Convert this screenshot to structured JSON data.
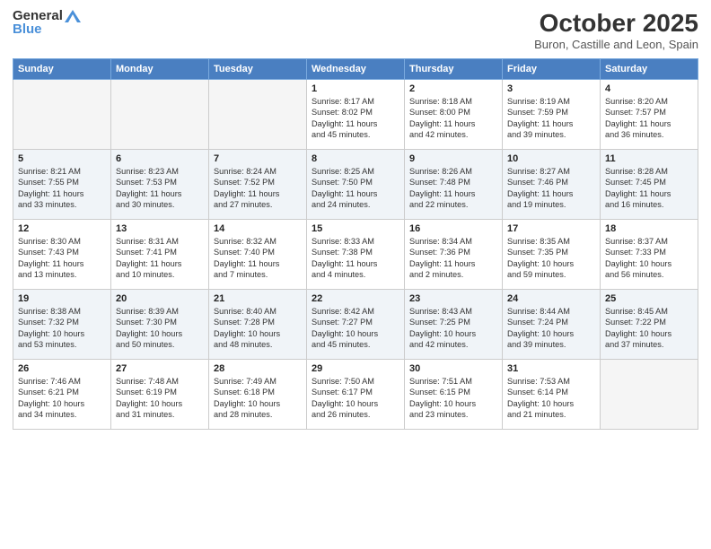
{
  "header": {
    "logo_general": "General",
    "logo_blue": "Blue",
    "month_title": "October 2025",
    "subtitle": "Buron, Castille and Leon, Spain"
  },
  "weekdays": [
    "Sunday",
    "Monday",
    "Tuesday",
    "Wednesday",
    "Thursday",
    "Friday",
    "Saturday"
  ],
  "weeks": [
    [
      {
        "day": "",
        "info": ""
      },
      {
        "day": "",
        "info": ""
      },
      {
        "day": "",
        "info": ""
      },
      {
        "day": "1",
        "info": "Sunrise: 8:17 AM\nSunset: 8:02 PM\nDaylight: 11 hours\nand 45 minutes."
      },
      {
        "day": "2",
        "info": "Sunrise: 8:18 AM\nSunset: 8:00 PM\nDaylight: 11 hours\nand 42 minutes."
      },
      {
        "day": "3",
        "info": "Sunrise: 8:19 AM\nSunset: 7:59 PM\nDaylight: 11 hours\nand 39 minutes."
      },
      {
        "day": "4",
        "info": "Sunrise: 8:20 AM\nSunset: 7:57 PM\nDaylight: 11 hours\nand 36 minutes."
      }
    ],
    [
      {
        "day": "5",
        "info": "Sunrise: 8:21 AM\nSunset: 7:55 PM\nDaylight: 11 hours\nand 33 minutes."
      },
      {
        "day": "6",
        "info": "Sunrise: 8:23 AM\nSunset: 7:53 PM\nDaylight: 11 hours\nand 30 minutes."
      },
      {
        "day": "7",
        "info": "Sunrise: 8:24 AM\nSunset: 7:52 PM\nDaylight: 11 hours\nand 27 minutes."
      },
      {
        "day": "8",
        "info": "Sunrise: 8:25 AM\nSunset: 7:50 PM\nDaylight: 11 hours\nand 24 minutes."
      },
      {
        "day": "9",
        "info": "Sunrise: 8:26 AM\nSunset: 7:48 PM\nDaylight: 11 hours\nand 22 minutes."
      },
      {
        "day": "10",
        "info": "Sunrise: 8:27 AM\nSunset: 7:46 PM\nDaylight: 11 hours\nand 19 minutes."
      },
      {
        "day": "11",
        "info": "Sunrise: 8:28 AM\nSunset: 7:45 PM\nDaylight: 11 hours\nand 16 minutes."
      }
    ],
    [
      {
        "day": "12",
        "info": "Sunrise: 8:30 AM\nSunset: 7:43 PM\nDaylight: 11 hours\nand 13 minutes."
      },
      {
        "day": "13",
        "info": "Sunrise: 8:31 AM\nSunset: 7:41 PM\nDaylight: 11 hours\nand 10 minutes."
      },
      {
        "day": "14",
        "info": "Sunrise: 8:32 AM\nSunset: 7:40 PM\nDaylight: 11 hours\nand 7 minutes."
      },
      {
        "day": "15",
        "info": "Sunrise: 8:33 AM\nSunset: 7:38 PM\nDaylight: 11 hours\nand 4 minutes."
      },
      {
        "day": "16",
        "info": "Sunrise: 8:34 AM\nSunset: 7:36 PM\nDaylight: 11 hours\nand 2 minutes."
      },
      {
        "day": "17",
        "info": "Sunrise: 8:35 AM\nSunset: 7:35 PM\nDaylight: 10 hours\nand 59 minutes."
      },
      {
        "day": "18",
        "info": "Sunrise: 8:37 AM\nSunset: 7:33 PM\nDaylight: 10 hours\nand 56 minutes."
      }
    ],
    [
      {
        "day": "19",
        "info": "Sunrise: 8:38 AM\nSunset: 7:32 PM\nDaylight: 10 hours\nand 53 minutes."
      },
      {
        "day": "20",
        "info": "Sunrise: 8:39 AM\nSunset: 7:30 PM\nDaylight: 10 hours\nand 50 minutes."
      },
      {
        "day": "21",
        "info": "Sunrise: 8:40 AM\nSunset: 7:28 PM\nDaylight: 10 hours\nand 48 minutes."
      },
      {
        "day": "22",
        "info": "Sunrise: 8:42 AM\nSunset: 7:27 PM\nDaylight: 10 hours\nand 45 minutes."
      },
      {
        "day": "23",
        "info": "Sunrise: 8:43 AM\nSunset: 7:25 PM\nDaylight: 10 hours\nand 42 minutes."
      },
      {
        "day": "24",
        "info": "Sunrise: 8:44 AM\nSunset: 7:24 PM\nDaylight: 10 hours\nand 39 minutes."
      },
      {
        "day": "25",
        "info": "Sunrise: 8:45 AM\nSunset: 7:22 PM\nDaylight: 10 hours\nand 37 minutes."
      }
    ],
    [
      {
        "day": "26",
        "info": "Sunrise: 7:46 AM\nSunset: 6:21 PM\nDaylight: 10 hours\nand 34 minutes."
      },
      {
        "day": "27",
        "info": "Sunrise: 7:48 AM\nSunset: 6:19 PM\nDaylight: 10 hours\nand 31 minutes."
      },
      {
        "day": "28",
        "info": "Sunrise: 7:49 AM\nSunset: 6:18 PM\nDaylight: 10 hours\nand 28 minutes."
      },
      {
        "day": "29",
        "info": "Sunrise: 7:50 AM\nSunset: 6:17 PM\nDaylight: 10 hours\nand 26 minutes."
      },
      {
        "day": "30",
        "info": "Sunrise: 7:51 AM\nSunset: 6:15 PM\nDaylight: 10 hours\nand 23 minutes."
      },
      {
        "day": "31",
        "info": "Sunrise: 7:53 AM\nSunset: 6:14 PM\nDaylight: 10 hours\nand 21 minutes."
      },
      {
        "day": "",
        "info": ""
      }
    ]
  ]
}
